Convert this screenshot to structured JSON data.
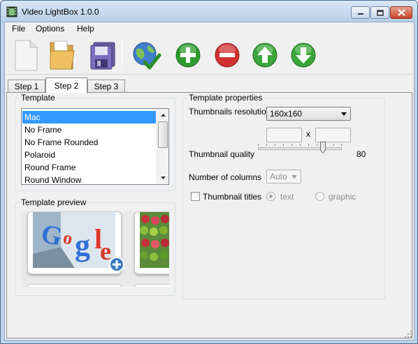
{
  "window": {
    "title": "Video LightBox 1.0.0"
  },
  "menu": {
    "items": [
      "File",
      "Options",
      "Help"
    ]
  },
  "toolbar": {
    "buttons": [
      {
        "name": "new-project",
        "icon": "blank-document-icon"
      },
      {
        "name": "open-project",
        "icon": "open-folder-icon"
      },
      {
        "name": "save-project",
        "icon": "floppy-disk-icon"
      },
      {
        "name": "publish",
        "icon": "globe-check-icon"
      },
      {
        "name": "add-video",
        "icon": "plus-circle-icon"
      },
      {
        "name": "remove-video",
        "icon": "minus-circle-icon"
      },
      {
        "name": "move-up",
        "icon": "arrow-up-circle-icon"
      },
      {
        "name": "move-down",
        "icon": "arrow-down-circle-icon"
      }
    ]
  },
  "tabs": [
    "Step 1",
    "Step 2",
    "Step 3"
  ],
  "active_tab": "Step 2",
  "template": {
    "group_label": "Template",
    "items": [
      "Mac",
      "No Frame",
      "No Frame Rounded",
      "Polaroid",
      "Round Frame",
      "Round Window"
    ],
    "selected": "Mac"
  },
  "preview": {
    "group_label": "Template preview"
  },
  "properties": {
    "group_label": "Template properties",
    "resolution_label": "Thumbnails resolution",
    "resolution_value": "160x160",
    "width_value": "",
    "height_value": "",
    "times_sign": "x",
    "quality_label": "Thumbnail quality",
    "quality_value": "80",
    "quality_fraction": 0.8,
    "columns_label": "Number of columns",
    "columns_value": "Auto",
    "titles_label": "Thumbnail titles",
    "titles_checked": false,
    "text_option": "text",
    "graphic_option": "graphic"
  },
  "colors": {
    "selection": "#3399ff",
    "add_green": "#2e9a2e",
    "remove_red": "#d23030",
    "move_green": "#3aa63a"
  }
}
